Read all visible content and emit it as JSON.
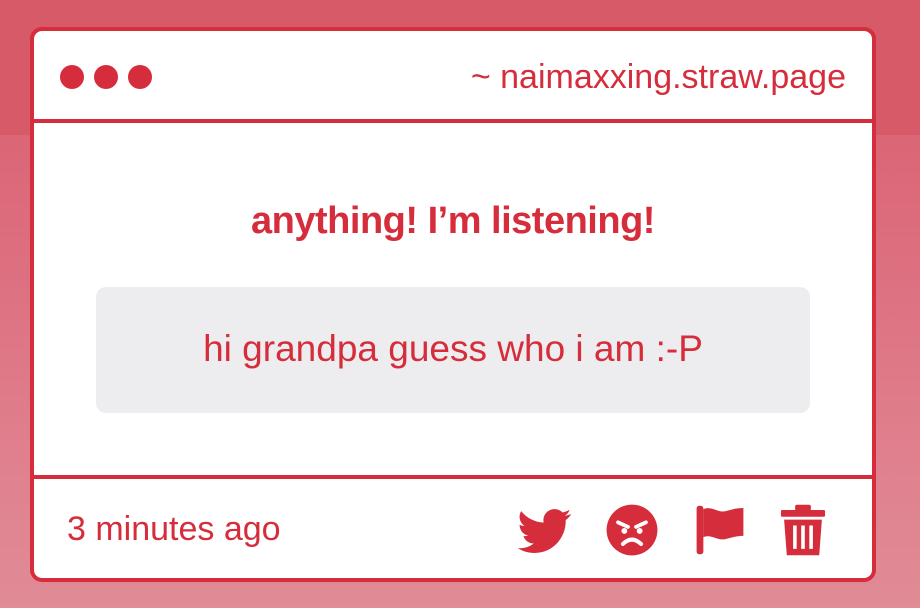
{
  "colors": {
    "accent": "#d52d3b",
    "card_background": "#ffffff",
    "answer_background": "#ededef",
    "page_background": "#dd7080"
  },
  "window": {
    "dots": [
      "dot",
      "dot",
      "dot"
    ],
    "url": "~ naimaxxing.straw.page"
  },
  "message": {
    "question": "anything! I’m listening!",
    "answer": "hi grandpa guess who i am :-P"
  },
  "footer": {
    "time": "3 minutes ago",
    "actions": [
      {
        "name": "twitter-share",
        "icon": "twitter-bird-icon"
      },
      {
        "name": "angry-react",
        "icon": "angry-face-icon"
      },
      {
        "name": "report",
        "icon": "flag-icon"
      },
      {
        "name": "delete",
        "icon": "trash-icon"
      }
    ]
  }
}
